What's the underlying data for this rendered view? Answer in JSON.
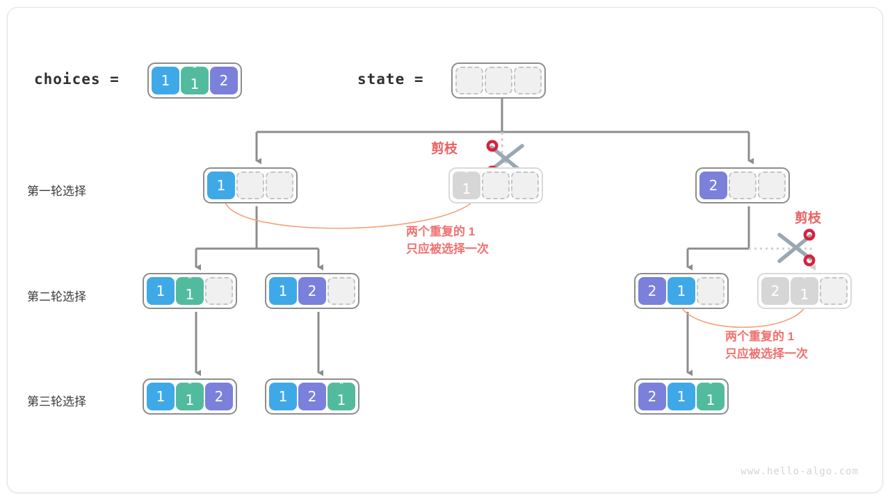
{
  "figure": {
    "watermark": "www.hello-algo.com",
    "colors": {
      "blue": "#3fa9e8",
      "green": "#52bb9e",
      "purple": "#7b80db",
      "gray": "#d6d6d6",
      "empty": "#f0f0f0",
      "edge": "#8c8c8c",
      "prune_red": "#ec5f5f",
      "note_red": "#f0716f",
      "arc_orange": "#f3a07a"
    }
  },
  "header": {
    "choices_label": "choices =",
    "state_label": "state =",
    "choices_cells": [
      {
        "text": "1",
        "color": "blue",
        "hat": false
      },
      {
        "text": "1",
        "color": "green",
        "hat": true
      },
      {
        "text": "2",
        "color": "purple",
        "hat": false
      }
    ],
    "state_cells": [
      {
        "text": "",
        "color": "empty",
        "hat": false
      },
      {
        "text": "",
        "color": "empty",
        "hat": false
      },
      {
        "text": "",
        "color": "empty",
        "hat": false
      }
    ]
  },
  "row_labels": [
    {
      "id": "round-1",
      "text": "第一轮选择"
    },
    {
      "id": "round-2",
      "text": "第二轮选择"
    },
    {
      "id": "round-3",
      "text": "第三轮选择"
    }
  ],
  "level1": [
    {
      "id": "l1-n1",
      "pruned": false,
      "cells": [
        {
          "text": "1",
          "color": "blue",
          "hat": false
        },
        {
          "text": "",
          "color": "empty",
          "hat": false
        },
        {
          "text": "",
          "color": "empty",
          "hat": false
        }
      ]
    },
    {
      "id": "l1-n2",
      "pruned": true,
      "cells": [
        {
          "text": "1",
          "color": "gray",
          "hat": true
        },
        {
          "text": "",
          "color": "empty",
          "hat": false
        },
        {
          "text": "",
          "color": "empty",
          "hat": false
        }
      ]
    },
    {
      "id": "l1-n3",
      "pruned": false,
      "cells": [
        {
          "text": "2",
          "color": "purple",
          "hat": false
        },
        {
          "text": "",
          "color": "empty",
          "hat": false
        },
        {
          "text": "",
          "color": "empty",
          "hat": false
        }
      ]
    }
  ],
  "level2": [
    {
      "id": "l2-n1",
      "pruned": false,
      "cells": [
        {
          "text": "1",
          "color": "blue",
          "hat": false
        },
        {
          "text": "1",
          "color": "green",
          "hat": true
        },
        {
          "text": "",
          "color": "empty",
          "hat": false
        }
      ]
    },
    {
      "id": "l2-n2",
      "pruned": false,
      "cells": [
        {
          "text": "1",
          "color": "blue",
          "hat": false
        },
        {
          "text": "2",
          "color": "purple",
          "hat": false
        },
        {
          "text": "",
          "color": "empty",
          "hat": false
        }
      ]
    },
    {
      "id": "l2-n3",
      "pruned": false,
      "cells": [
        {
          "text": "2",
          "color": "purple",
          "hat": false
        },
        {
          "text": "1",
          "color": "blue",
          "hat": false
        },
        {
          "text": "",
          "color": "empty",
          "hat": false
        }
      ]
    },
    {
      "id": "l2-n4",
      "pruned": true,
      "cells": [
        {
          "text": "2",
          "color": "gray",
          "hat": false
        },
        {
          "text": "1",
          "color": "gray",
          "hat": true
        },
        {
          "text": "",
          "color": "empty",
          "hat": false
        }
      ]
    }
  ],
  "level3": [
    {
      "id": "l3-n1",
      "pruned": false,
      "cells": [
        {
          "text": "1",
          "color": "blue",
          "hat": false
        },
        {
          "text": "1",
          "color": "green",
          "hat": true
        },
        {
          "text": "2",
          "color": "purple",
          "hat": false
        }
      ]
    },
    {
      "id": "l3-n2",
      "pruned": false,
      "cells": [
        {
          "text": "1",
          "color": "blue",
          "hat": false
        },
        {
          "text": "2",
          "color": "purple",
          "hat": false
        },
        {
          "text": "1",
          "color": "green",
          "hat": true
        }
      ]
    },
    {
      "id": "l3-n3",
      "pruned": false,
      "cells": [
        {
          "text": "2",
          "color": "purple",
          "hat": false
        },
        {
          "text": "1",
          "color": "blue",
          "hat": false
        },
        {
          "text": "1",
          "color": "green",
          "hat": true
        }
      ]
    }
  ],
  "annotations": {
    "prune_left_label": "剪枝",
    "prune_right_label": "剪枝",
    "note_left_line1": "两个重复的 1",
    "note_left_line2": "只应被选择一次",
    "note_right_line1": "两个重复的 1",
    "note_right_line2": "只应被选择一次"
  }
}
